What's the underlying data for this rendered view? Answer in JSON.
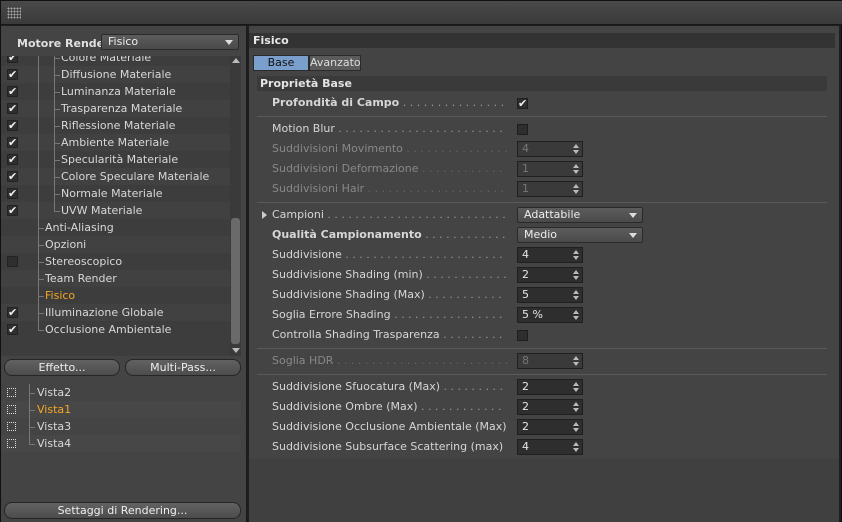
{
  "left": {
    "engine_label": "Motore Render",
    "engine_value": "Fisico",
    "tree": [
      {
        "label": "Colore Materiale",
        "checked": true,
        "indent": 1,
        "partial": true
      },
      {
        "label": "Diffusione Materiale",
        "checked": true,
        "indent": 1
      },
      {
        "label": "Luminanza Materiale",
        "checked": true,
        "indent": 1
      },
      {
        "label": "Trasparenza Materiale",
        "checked": true,
        "indent": 1
      },
      {
        "label": "Riflessione Materiale",
        "checked": true,
        "indent": 1
      },
      {
        "label": "Ambiente Materiale",
        "checked": true,
        "indent": 1
      },
      {
        "label": "Specularità Materiale",
        "checked": true,
        "indent": 1
      },
      {
        "label": "Colore Speculare Materiale",
        "checked": true,
        "indent": 1
      },
      {
        "label": "Normale Materiale",
        "checked": true,
        "indent": 1
      },
      {
        "label": "UVW Materiale",
        "checked": true,
        "indent": 1
      },
      {
        "label": "Anti-Aliasing",
        "checked": null,
        "indent": 0
      },
      {
        "label": "Opzioni",
        "checked": null,
        "indent": 0
      },
      {
        "label": "Stereoscopico",
        "checked": false,
        "indent": 0
      },
      {
        "label": "Team Render",
        "checked": null,
        "indent": 0
      },
      {
        "label": "Fisico",
        "checked": null,
        "indent": 0,
        "active": true
      },
      {
        "label": "Illuminazione Globale",
        "checked": true,
        "indent": 0
      },
      {
        "label": "Occlusione Ambientale",
        "checked": true,
        "indent": 0
      }
    ],
    "btn_effect": "Effetto...",
    "btn_multipass": "Multi-Pass...",
    "views": [
      {
        "label": "Vista2",
        "active": false
      },
      {
        "label": "Vista1",
        "active": true
      },
      {
        "label": "Vista3",
        "active": false
      },
      {
        "label": "Vista4",
        "active": false
      }
    ],
    "btn_settings": "Settaggi di Rendering..."
  },
  "right": {
    "panel_title": "Fisico",
    "tabs": [
      {
        "label": "Base",
        "active": true
      },
      {
        "label": "Avanzato",
        "active": false
      }
    ],
    "section_title": "Proprietà Base",
    "props": [
      {
        "label": "Profondità di Campo",
        "type": "check",
        "checked": true,
        "bold": true
      },
      {
        "sep": true
      },
      {
        "label": "Motion Blur",
        "type": "check",
        "checked": false
      },
      {
        "label": "Suddivisioni Movimento",
        "type": "num",
        "value": "4",
        "disabled": true
      },
      {
        "label": "Suddivisioni Deformazione",
        "type": "num",
        "value": "1",
        "disabled": true
      },
      {
        "label": "Suddivisioni Hair",
        "type": "num",
        "value": "1",
        "disabled": true
      },
      {
        "sep": true
      },
      {
        "label": "Campioni",
        "type": "dd",
        "value": "Adattabile",
        "expand": true
      },
      {
        "label": "Qualità Campionamento",
        "type": "dd",
        "value": "Medio",
        "bold": true
      },
      {
        "label": "Suddivisione",
        "type": "num",
        "value": "4"
      },
      {
        "label": "Suddivisione Shading (min)",
        "type": "num",
        "value": "2"
      },
      {
        "label": "Suddivisione Shading (Max)",
        "type": "num",
        "value": "5"
      },
      {
        "label": "Soglia Errore Shading",
        "type": "num",
        "value": "5 %"
      },
      {
        "label": "Controlla Shading Trasparenza",
        "type": "check",
        "checked": false
      },
      {
        "sep": true
      },
      {
        "label": "Soglia HDR",
        "type": "num",
        "value": "8",
        "disabled": true
      },
      {
        "sep": true
      },
      {
        "label": "Suddivisione Sfuocatura (Max)",
        "type": "num",
        "value": "2"
      },
      {
        "label": "Suddivisione Ombre (Max)",
        "type": "num",
        "value": "2"
      },
      {
        "label": "Suddivisione Occlusione Ambientale (Max)",
        "type": "num",
        "value": "2"
      },
      {
        "label": "Suddivisione Subsurface Scattering (max)",
        "type": "num",
        "value": "4"
      }
    ]
  }
}
